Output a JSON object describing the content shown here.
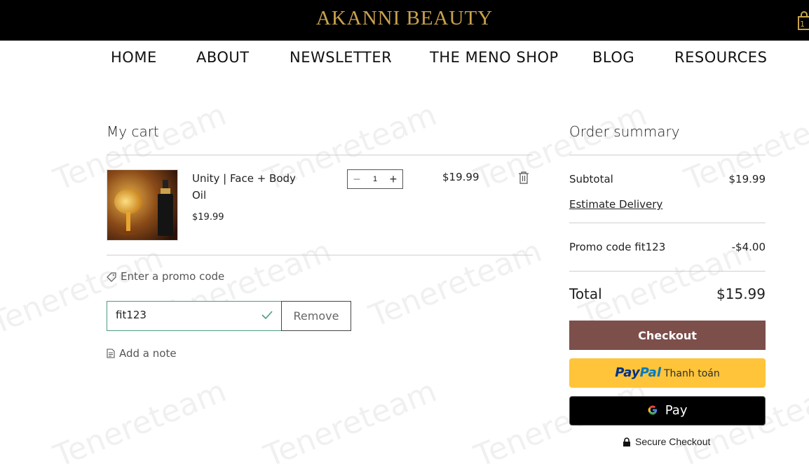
{
  "brand": {
    "name": "AKANNI BEAUTY",
    "accent": "#c9a24d"
  },
  "cart_badge": {
    "count": "1"
  },
  "nav": {
    "items": [
      "HOME",
      "ABOUT",
      "NEWSLETTER",
      "THE MENO SHOP",
      "BLOG",
      "RESOURCES"
    ]
  },
  "cart": {
    "title": "My cart",
    "item": {
      "name": "Unity | Face + Body Oil",
      "unit_price": "$19.99",
      "quantity": "1",
      "line_total": "$19.99"
    },
    "promo_link": "Enter a promo code",
    "promo_value": "fit123",
    "remove_label": "Remove",
    "note_link": "Add a note"
  },
  "summary": {
    "title": "Order summary",
    "subtotal_label": "Subtotal",
    "subtotal_value": "$19.99",
    "estimate_link": "Estimate Delivery",
    "promo_label": "Promo code fit123",
    "promo_value": "-$4.00",
    "total_label": "Total",
    "total_value": "$15.99",
    "checkout_label": "Checkout",
    "paypal": {
      "pay": "Pay",
      "pal": "Pal",
      "text": "Thanh toán"
    },
    "gpay": {
      "g": "G",
      "pay": "Pay"
    },
    "secure_label": "Secure Checkout"
  },
  "colors": {
    "checkout_bg": "#7d4f4b",
    "paypal_bg": "#ffc439",
    "promo_border": "#4f9b7a"
  },
  "watermark": "Tenereteam"
}
